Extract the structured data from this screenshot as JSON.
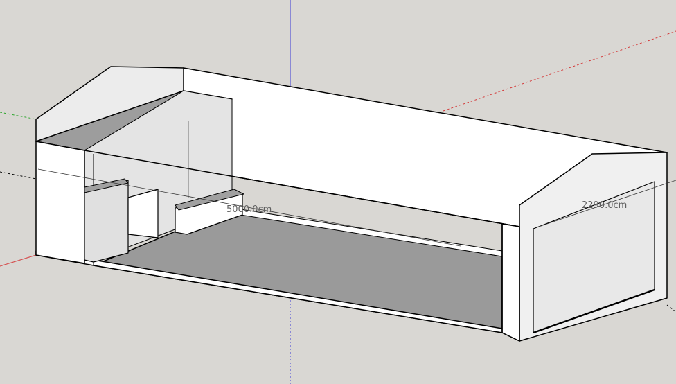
{
  "viewport": {
    "background": "#d9d7d3",
    "model": "building-section-model",
    "colors": {
      "wall_face": "#ffffff",
      "wall_shade": "#dedede",
      "top_cut": "#9d9d9d",
      "floor": "#9a9a9a",
      "edge": "#000000",
      "axis_red": "#d43a3a",
      "axis_green": "#2fa62f",
      "axis_blue": "#3a3ad4"
    }
  },
  "dimensions": {
    "length_label": "5000.0cm",
    "width_label": "2290.0cm"
  }
}
